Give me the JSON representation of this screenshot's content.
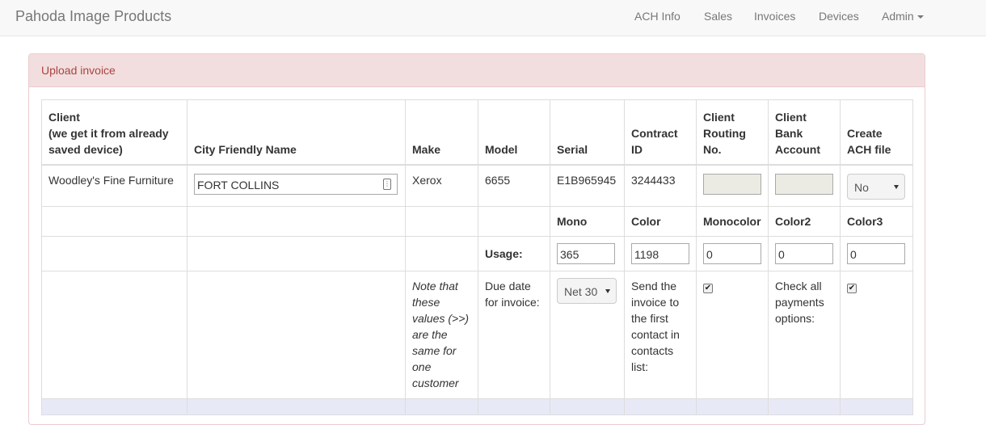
{
  "brand": "Pahoda Image Products",
  "nav": {
    "ach_info": "ACH Info",
    "sales": "Sales",
    "invoices": "Invoices",
    "devices": "Devices",
    "admin": "Admin"
  },
  "panel": {
    "heading": "Upload invoice"
  },
  "table": {
    "headers": {
      "client_line1": "Client",
      "client_line2": "(we get it from already",
      "client_line3": "saved device)",
      "city": "City Friendly Name",
      "make": "Make",
      "model": "Model",
      "serial": "Serial",
      "contract_id": "Contract ID",
      "routing": "Client Routing No.",
      "bank": "Client Bank Account",
      "ach": "Create ACH file"
    },
    "row": {
      "client": "Woodley's Fine Furniture",
      "city_value": "FORT COLLINS",
      "make": "Xerox",
      "model": "6655",
      "serial": "E1B965945",
      "contract_id": "3244433",
      "routing_value": "",
      "bank_value": "",
      "ach_selected": "No"
    },
    "meter_headers": {
      "mono": "Mono",
      "color": "Color",
      "monocolor": "Monocolor",
      "color2": "Color2",
      "color3": "Color3"
    },
    "usage": {
      "label": "Usage:",
      "mono": "365",
      "color": "1198",
      "monocolor": "0",
      "color2": "0",
      "color3": "0"
    },
    "options": {
      "note": "Note that these values (>>) are the same for one customer",
      "due_label": "Due date for invoice:",
      "due_selected": "Net 30",
      "send_label": "Send the invoice to the first contact in contacts list:",
      "send_checked": "✔",
      "check_all_label": "Check all payments options:",
      "check_all_checked": "✔"
    }
  }
}
